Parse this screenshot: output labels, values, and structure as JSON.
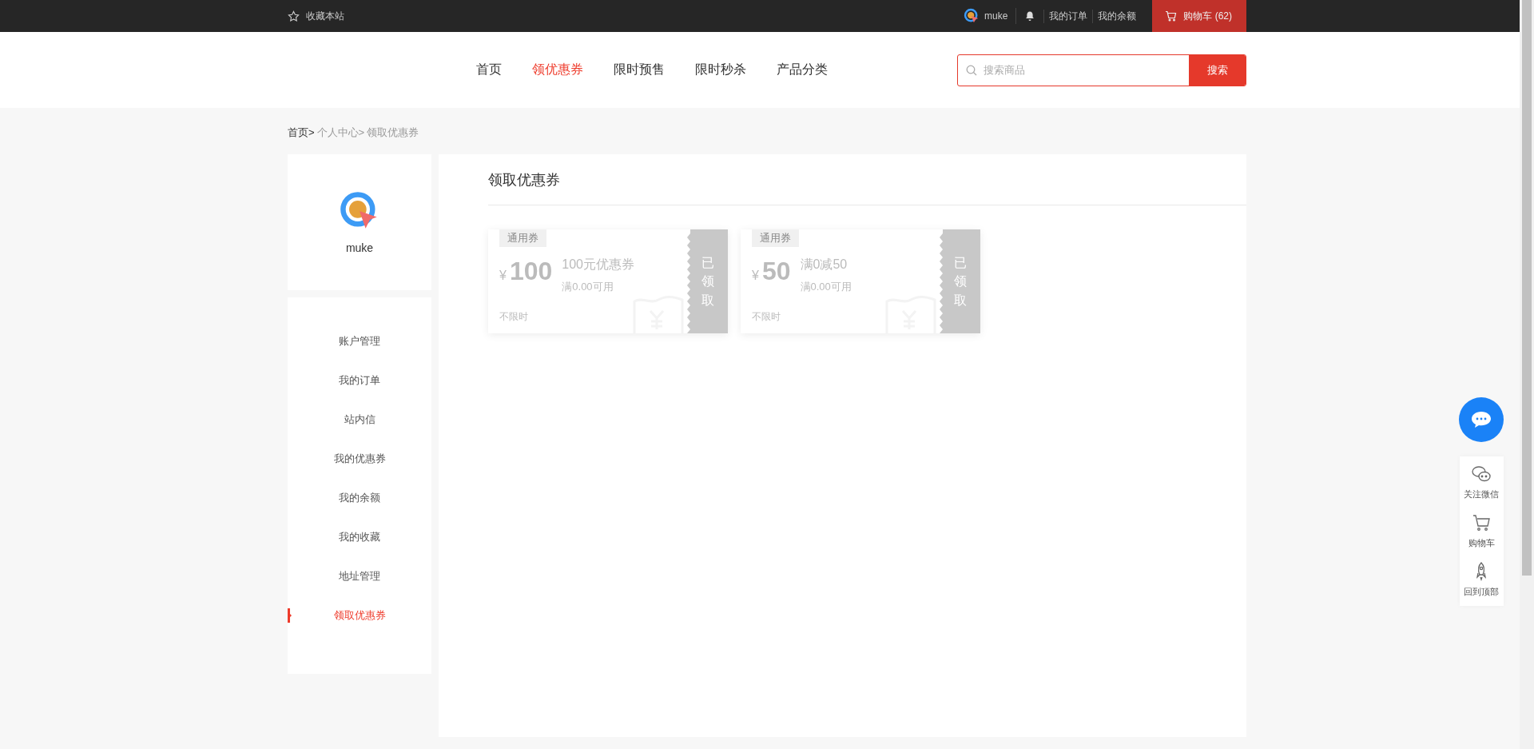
{
  "top_bar": {
    "favorite": "收藏本站",
    "username": "muke",
    "links": [
      "我的订单",
      "我的余额"
    ],
    "cart": "购物车 (62)"
  },
  "nav": {
    "items": [
      {
        "label": "首页",
        "selected": false
      },
      {
        "label": "领优惠券",
        "selected": true
      },
      {
        "label": "限时预售",
        "selected": false
      },
      {
        "label": "限时秒杀",
        "selected": false
      },
      {
        "label": "产品分类",
        "selected": false
      }
    ],
    "search": {
      "placeholder": "搜索商品",
      "button": "搜索"
    }
  },
  "breadcrumb": [
    "首页>",
    "个人中心>",
    "领取优惠券"
  ],
  "profile": {
    "username": "muke"
  },
  "sidebar": {
    "items": [
      {
        "label": "账户管理",
        "selected": false
      },
      {
        "label": "我的订单",
        "selected": false
      },
      {
        "label": "站内信",
        "selected": false
      },
      {
        "label": "我的优惠券",
        "selected": false
      },
      {
        "label": "我的余额",
        "selected": false
      },
      {
        "label": "我的收藏",
        "selected": false
      },
      {
        "label": "地址管理",
        "selected": false
      },
      {
        "label": "领取优惠券",
        "selected": true
      }
    ]
  },
  "main": {
    "title": "领取优惠券",
    "coupons": [
      {
        "tag": "通用券",
        "currency": "¥",
        "amount": "100",
        "name": "100元优惠券",
        "condition": "满0.00可用",
        "validity": "不限时",
        "claimed": true,
        "stamp": "已领取"
      },
      {
        "tag": "通用券",
        "currency": "¥",
        "amount": "50",
        "name": "满0减50",
        "condition": "满0.00可用",
        "validity": "不限时",
        "claimed": true,
        "stamp": "已领取"
      }
    ]
  },
  "float_tools": [
    {
      "label": "关注微信",
      "kind": "wechat"
    },
    {
      "label": "购物车",
      "kind": "cart"
    },
    {
      "label": "回到顶部",
      "kind": "rocket"
    }
  ]
}
